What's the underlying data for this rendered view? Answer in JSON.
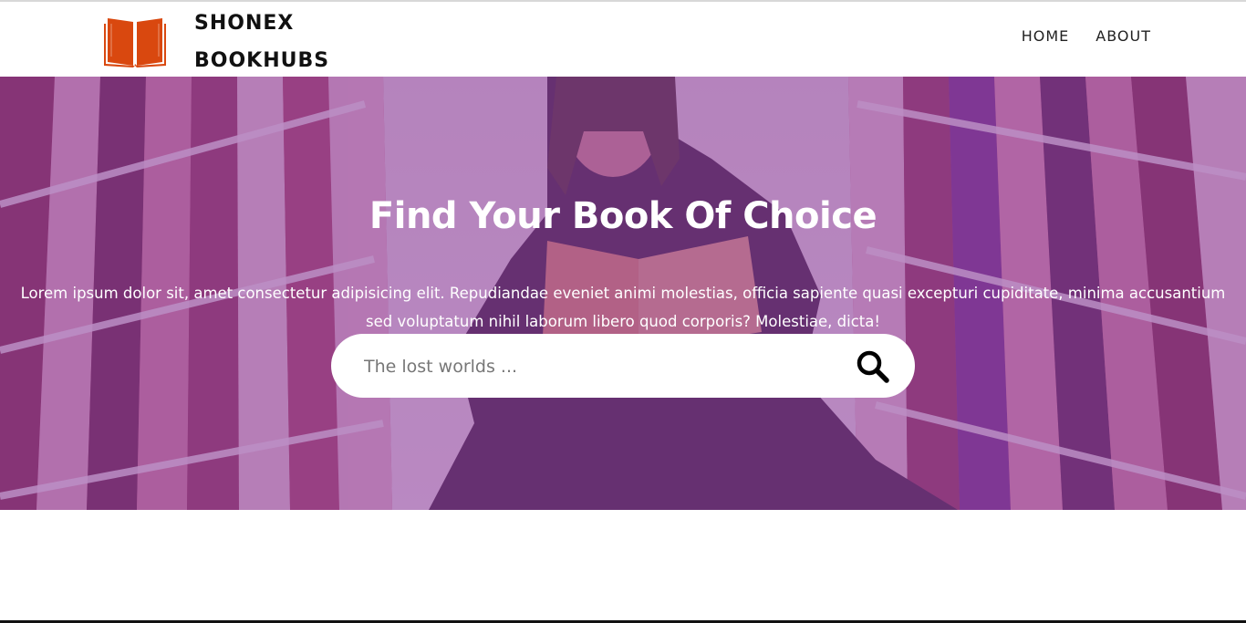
{
  "brand": {
    "line1": "SHONEX",
    "line2": "BOOKHUBS",
    "logo_icon": "open-book-icon",
    "logo_color": "#d9480f"
  },
  "nav": {
    "items": [
      {
        "label": "HOME"
      },
      {
        "label": "ABOUT"
      }
    ]
  },
  "hero": {
    "title": "Find Your Book Of Choice",
    "text": "Lorem ipsum dolor sit, amet consectetur adipisicing elit. Repudiandae eveniet animi molestias, officia sapiente quasi excepturi cupiditate, minima accusantium sed voluptatum nihil laborum libero quod corporis? Molestiae, dicta!",
    "overlay_color": "#8b3fa0",
    "background": "library-reader-photo"
  },
  "search": {
    "placeholder": "The lost worlds ...",
    "value": "",
    "icon": "search-icon"
  }
}
